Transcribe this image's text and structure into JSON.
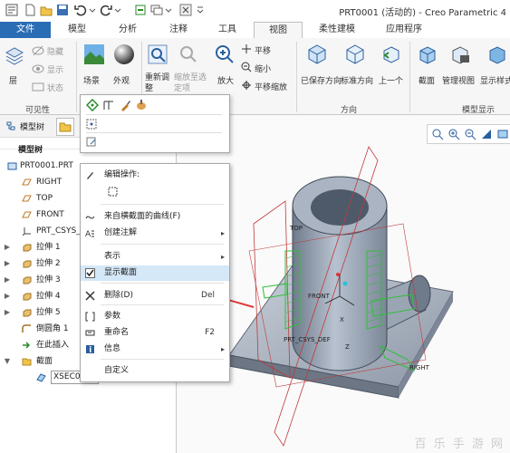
{
  "window": {
    "title": "PRT0001 (活动的) - Creo Parametric 4"
  },
  "tabs": [
    {
      "label": "文件"
    },
    {
      "label": "模型"
    },
    {
      "label": "分析"
    },
    {
      "label": "注释"
    },
    {
      "label": "工具"
    },
    {
      "label": "视图"
    },
    {
      "label": "柔性建模"
    },
    {
      "label": "应用程序"
    }
  ],
  "ribbon": {
    "visibility": {
      "layers": "层",
      "hide": "隐藏",
      "show": "显示",
      "status": "状态",
      "group": "可见性"
    },
    "scene": "场景",
    "appearance": "外观",
    "regen": "重新调整",
    "zoom_selected": "缩放至选定项",
    "zoom_in": "放大",
    "pan": "平移",
    "zoom_out": "缩小",
    "pan_zoom": "平移缩放",
    "direction": {
      "saved": "已保存方向",
      "standard": "标准方向",
      "previous": "上一个",
      "group": "方向"
    },
    "model_display": {
      "section": "截面",
      "manage_views": "管理视图",
      "display_style": "显示样式",
      "group": "模型显示"
    }
  },
  "panel": {
    "tabs": [
      "模型树"
    ],
    "header": "模型树",
    "tree": [
      {
        "label": "PRT0001.PRT",
        "icon": "part-icon",
        "indent": 0,
        "twisty": ""
      },
      {
        "label": "RIGHT",
        "icon": "datum-plane-icon",
        "indent": 1,
        "twisty": ""
      },
      {
        "label": "TOP",
        "icon": "datum-plane-icon",
        "indent": 1,
        "twisty": ""
      },
      {
        "label": "FRONT",
        "icon": "datum-plane-icon",
        "indent": 1,
        "twisty": ""
      },
      {
        "label": "PRT_CSYS_DEF",
        "icon": "csys-icon",
        "indent": 1,
        "twisty": ""
      },
      {
        "label": "拉伸 1",
        "icon": "extrude-icon",
        "indent": 1,
        "twisty": "▶"
      },
      {
        "label": "拉伸 2",
        "icon": "extrude-icon",
        "indent": 1,
        "twisty": "▶"
      },
      {
        "label": "拉伸 3",
        "icon": "extrude-icon",
        "indent": 1,
        "twisty": "▶"
      },
      {
        "label": "拉伸 4",
        "icon": "extrude-icon",
        "indent": 1,
        "twisty": "▶"
      },
      {
        "label": "拉伸 5",
        "icon": "extrude-icon",
        "indent": 1,
        "twisty": "▶"
      },
      {
        "label": "倒圆角 1",
        "icon": "round-icon",
        "indent": 1,
        "twisty": ""
      },
      {
        "label": "在此插入",
        "icon": "insert-arrow-icon",
        "indent": 1,
        "twisty": ""
      },
      {
        "label": "截面",
        "icon": "folder-icon",
        "indent": 1,
        "twisty": "▼"
      },
      {
        "label": "XSEC0001",
        "icon": "section-icon",
        "indent": 2,
        "twisty": ""
      }
    ]
  },
  "context_menu": {
    "items": [
      {
        "label": "编辑操作:",
        "shortcut": "",
        "arrow": "",
        "icon": "pencil-icon",
        "highlight": false
      },
      {
        "label": "",
        "shortcut": "",
        "arrow": "",
        "icon": "edit-dimension-icon",
        "highlight": false
      },
      {
        "label": "来自横截面的曲线(F)",
        "shortcut": "",
        "arrow": "",
        "icon": "curve-icon",
        "highlight": false
      },
      {
        "label": "创建注解",
        "shortcut": "",
        "arrow": "▸",
        "icon": "annotation-icon",
        "highlight": false
      },
      {
        "label": "表示",
        "shortcut": "",
        "arrow": "▸",
        "icon": "",
        "highlight": false
      },
      {
        "label": "显示截面",
        "shortcut": "",
        "arrow": "",
        "icon": "checkbox-checked-icon",
        "highlight": true
      },
      {
        "label": "删除(D)",
        "shortcut": "Del",
        "arrow": "",
        "icon": "delete-icon",
        "highlight": false
      },
      {
        "label": "参数",
        "shortcut": "",
        "arrow": "",
        "icon": "parameters-icon",
        "highlight": false
      },
      {
        "label": "重命名",
        "shortcut": "F2",
        "arrow": "",
        "icon": "rename-icon",
        "highlight": false
      },
      {
        "label": "信息",
        "shortcut": "",
        "arrow": "▸",
        "icon": "info-icon",
        "highlight": false
      },
      {
        "label": "自定义",
        "shortcut": "",
        "arrow": "",
        "icon": "",
        "highlight": false
      }
    ]
  },
  "viewport": {
    "labels": {
      "top": "TOP",
      "front": "FRONT",
      "csys": "PRT_CSYS_DEF",
      "right": "RIGHT",
      "z": "Z",
      "x": "X"
    }
  },
  "colors": {
    "file_tab": "#2b6db5",
    "highlight": "#d4e8f8",
    "arrow": "#e03a3a",
    "datum": "#c03a3a",
    "section": "#2fbf3a"
  },
  "watermark": "百 乐 手 游 网"
}
